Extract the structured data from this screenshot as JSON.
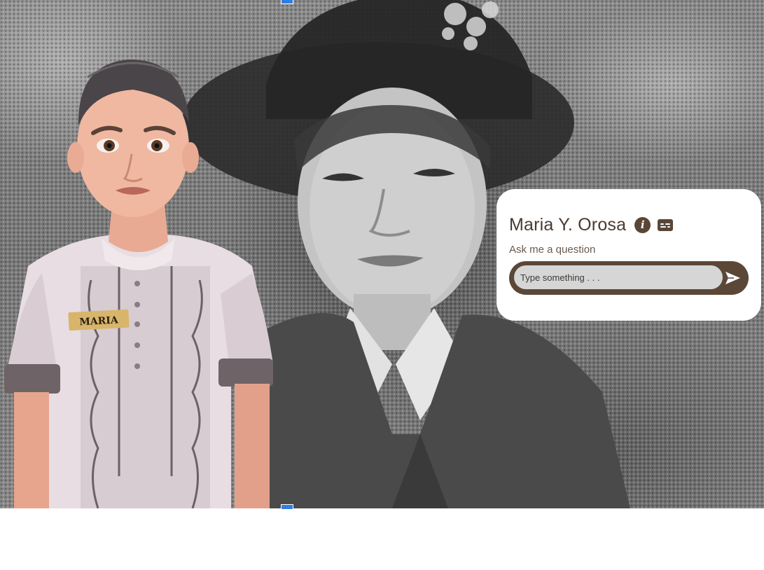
{
  "persona": {
    "name": "Maria Y. Orosa"
  },
  "chat": {
    "prompt": "Ask me a question",
    "input_placeholder": "Type something . . ."
  },
  "avatar": {
    "name_tag": "MARIA"
  },
  "colors": {
    "brand": "#5a4637",
    "card": "#ffffff",
    "input": "#d6d6d6"
  },
  "icons": {
    "info": "info-icon",
    "captions": "captions-icon",
    "send": "send-icon"
  }
}
